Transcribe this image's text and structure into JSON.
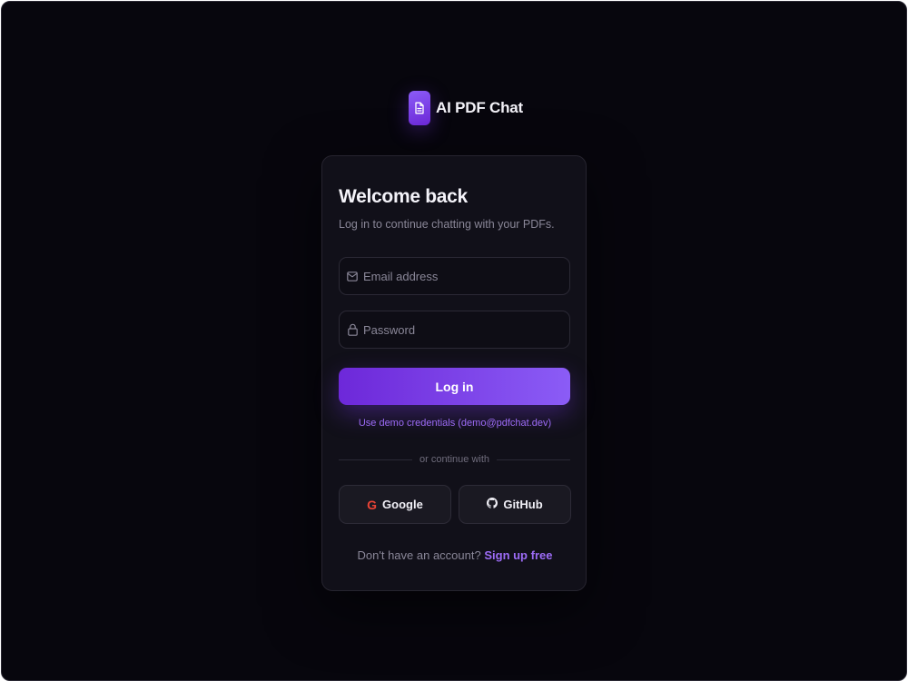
{
  "brand": {
    "name": "AI PDF Chat",
    "logo_icon": "document-icon"
  },
  "login": {
    "title": "Welcome back",
    "subtitle": "Log in to continue chatting with your PDFs.",
    "email": {
      "placeholder": "Email address",
      "value": "",
      "icon": "mail-icon"
    },
    "password": {
      "placeholder": "Password",
      "value": "",
      "icon": "lock-icon"
    },
    "submit_label": "Log in",
    "demo_link": "Use demo credentials (demo@pdfchat.dev)",
    "divider_text": "or continue with",
    "social": {
      "google_label": "Google",
      "github_label": "GitHub",
      "google_icon_glyph": "G"
    },
    "signup_prompt": "Don't have an account?",
    "signup_link": "Sign up free"
  },
  "colors": {
    "background": "#07060d",
    "card": "#111019",
    "accent_start": "#6d28d9",
    "accent_end": "#8b5cf6",
    "link": "#9d6cf7",
    "google_red": "#ea4335"
  }
}
